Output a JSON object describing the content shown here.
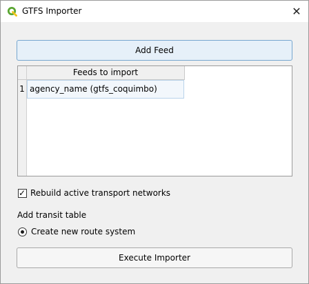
{
  "window": {
    "title": "GTFS Importer",
    "close_glyph": "✕",
    "app_icon": "qgis-logo-icon"
  },
  "actions": {
    "add_feed": "Add Feed",
    "execute": "Execute Importer"
  },
  "feeds_table": {
    "header": "Feeds to import",
    "rows": [
      {
        "index": "1",
        "value": "agency_name (gtfs_coquimbo)"
      }
    ]
  },
  "options": {
    "rebuild_label": "Rebuild active transport networks",
    "rebuild_checked": true,
    "check_glyph": "✓",
    "transit_table_label": "Add transit table",
    "route_system_label": "Create new route system",
    "route_system_selected": true
  },
  "colors": {
    "accent_border": "#76a6cf",
    "accent_fill": "#e6f0f9",
    "qgis_green": "#5aa632"
  }
}
